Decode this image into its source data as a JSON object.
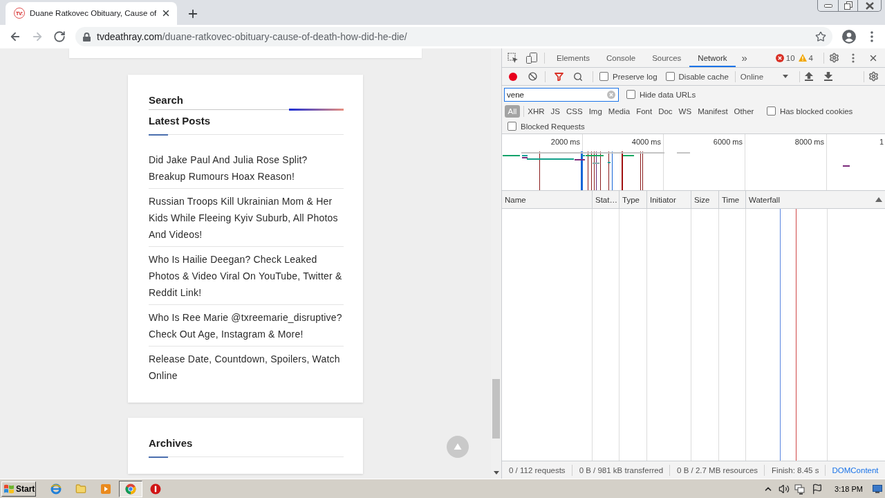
{
  "browser": {
    "tabs": [
      {
        "logo": "TV:",
        "title": "Duane Ratkovec Obituary, Cause of",
        "selected": true
      }
    ],
    "nav": [
      {
        "kind": "back",
        "disabled": false
      },
      {
        "kind": "forward",
        "disabled": true
      },
      {
        "kind": "reload",
        "disabled": false
      }
    ],
    "address": {
      "host": "tvdeathray.com",
      "path": "/duane-ratkovec-obituary-cause-of-death-how-did-he-die/"
    }
  },
  "page": {
    "cards": [
      {
        "sections": [
          {
            "kind": "search",
            "title": "Search"
          },
          {
            "kind": "posts",
            "title": "Latest Posts",
            "posts": [
              "Did Jake Paul And Julia Rose Split? Breakup Rumours Hoax Reason!",
              "Russian Troops Kill Ukrainian Mom & Her Kids While Fleeing Kyiv Suburb, All Photos And Videos!",
              "Who Is Hailie Deegan? Check Leaked Photos & Video Viral On YouTube, Twitter & Reddit Link!",
              "Who Is Ree Marie @txreemarie_disruptive? Check Out Age, Instagram & More!",
              "Release Date, Countdown, Spoilers, Watch Online"
            ]
          }
        ]
      },
      {
        "sections": [
          {
            "kind": "posts",
            "title": "Archives"
          }
        ]
      }
    ]
  },
  "devtools": {
    "panel_tabs": [
      {
        "label": "Elements",
        "selected": false
      },
      {
        "label": "Console",
        "selected": false
      },
      {
        "label": "Sources",
        "selected": false
      },
      {
        "label": "Network",
        "selected": true
      }
    ],
    "overflow": "»",
    "errors": "10",
    "warnings": "4",
    "recording": true,
    "options": [
      {
        "label": "Preserve log",
        "checked": false
      },
      {
        "label": "Disable cache",
        "checked": false
      }
    ],
    "throttling": "Online",
    "filter": {
      "value": "vene"
    },
    "hide_data_urls": {
      "label": "Hide data URLs",
      "checked": false
    },
    "types": [
      {
        "label": "All",
        "selected": true
      },
      {
        "label": "XHR",
        "selected": false
      },
      {
        "label": "JS",
        "selected": false
      },
      {
        "label": "CSS",
        "selected": false
      },
      {
        "label": "Img",
        "selected": false
      },
      {
        "label": "Media",
        "selected": false
      },
      {
        "label": "Font",
        "selected": false
      },
      {
        "label": "Doc",
        "selected": false
      },
      {
        "label": "WS",
        "selected": false
      },
      {
        "label": "Manifest",
        "selected": false
      },
      {
        "label": "Other",
        "selected": false
      }
    ],
    "has_blocked_cookies": {
      "label": "Has blocked cookies",
      "checked": false
    },
    "blocked_requests": {
      "label": "Blocked Requests",
      "checked": false
    },
    "overview_ticks": [
      "2000 ms",
      "4000 ms",
      "6000 ms",
      "8000 ms",
      "1"
    ],
    "columns": [
      {
        "label": "Name",
        "sorted": false
      },
      {
        "label": "Stat…",
        "sorted": false
      },
      {
        "label": "Type",
        "sorted": false
      },
      {
        "label": "Initiator",
        "sorted": false
      },
      {
        "label": "Size",
        "sorted": false
      },
      {
        "label": "Time",
        "sorted": false
      },
      {
        "label": "Waterfall",
        "sorted": true
      }
    ],
    "status": [
      {
        "text": "0 / 112 requests",
        "kind": "plain"
      },
      {
        "text": "0 B / 981 kB transferred",
        "kind": "plain"
      },
      {
        "text": "0 B / 2.7 MB resources",
        "kind": "plain"
      },
      {
        "text": "Finish: 8.45 s",
        "kind": "plain"
      },
      {
        "text": "DOMContent",
        "kind": "link"
      }
    ]
  },
  "taskbar": {
    "start": "Start",
    "apps": [
      {
        "kind": "ie",
        "selected": false
      },
      {
        "kind": "folder",
        "selected": false
      },
      {
        "kind": "media",
        "selected": false
      },
      {
        "kind": "chrome",
        "selected": true
      },
      {
        "kind": "stop",
        "selected": false
      }
    ],
    "clock": "3:18 PM"
  }
}
